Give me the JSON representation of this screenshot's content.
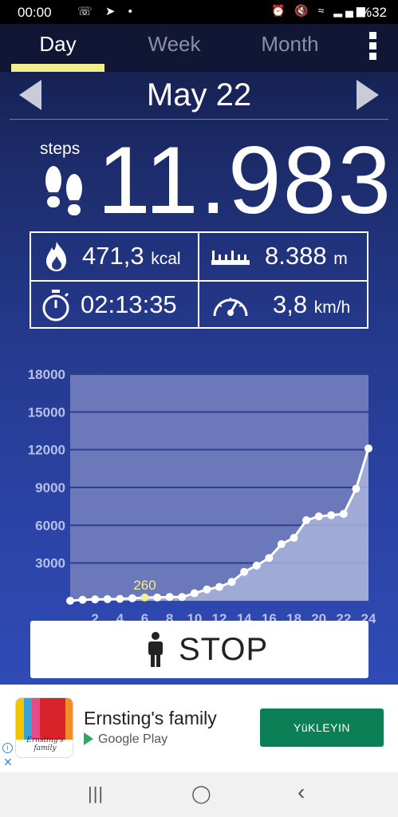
{
  "status_bar": {
    "time": "00:00",
    "battery": "%32",
    "left_icons": "☏ ➤ •",
    "right_icons": "⏰ 🔇 ≈ ▂▄▆"
  },
  "tabs": [
    {
      "label": "Day",
      "active": true
    },
    {
      "label": "Week",
      "active": false
    },
    {
      "label": "Month",
      "active": false
    }
  ],
  "date": "May 22",
  "steps": {
    "label": "steps",
    "value": "11.983"
  },
  "stats": {
    "calories": {
      "value": "471,3",
      "unit": "kcal"
    },
    "distance": {
      "value": "8.388",
      "unit": "m"
    },
    "duration": {
      "value": "02:13:35"
    },
    "speed": {
      "value": "3,8",
      "unit": "km/h"
    }
  },
  "chart_data": {
    "type": "area",
    "x": [
      0,
      1,
      2,
      3,
      4,
      5,
      6,
      7,
      8,
      9,
      10,
      11,
      12,
      13,
      14,
      15,
      16,
      17,
      18,
      19,
      20,
      21,
      22,
      23,
      24
    ],
    "values": [
      0,
      80,
      110,
      130,
      150,
      200,
      260,
      260,
      300,
      300,
      600,
      900,
      1100,
      1500,
      2300,
      2800,
      3400,
      4500,
      5000,
      6400,
      6700,
      6800,
      6900,
      8900,
      12100
    ],
    "xticks": [
      "2",
      "4",
      "6",
      "8",
      "10",
      "12",
      "14",
      "16",
      "18",
      "20",
      "22",
      "24"
    ],
    "yticks": [
      "3000",
      "6000",
      "9000",
      "12000",
      "15000",
      "18000"
    ],
    "ylim": [
      0,
      18000
    ],
    "highlight": {
      "x": 6,
      "label": "260"
    },
    "colors": {
      "line": "#ffffff",
      "fill": "#a9b3dc",
      "plot_bg": "#6b78ba",
      "grid": "#2e3f8f",
      "highlight": "#f1ee8e",
      "ticks": "#b7bfe6"
    }
  },
  "stop_button": {
    "label": "STOP"
  },
  "ad": {
    "title": "Ernsting's family",
    "store": "Google Play",
    "cta": "YüKLEYIN",
    "logo_text": "Ernsting's family",
    "info": "i",
    "close": "✕"
  },
  "nav": {
    "recents": "|||",
    "home": "◯",
    "back": "‹"
  }
}
